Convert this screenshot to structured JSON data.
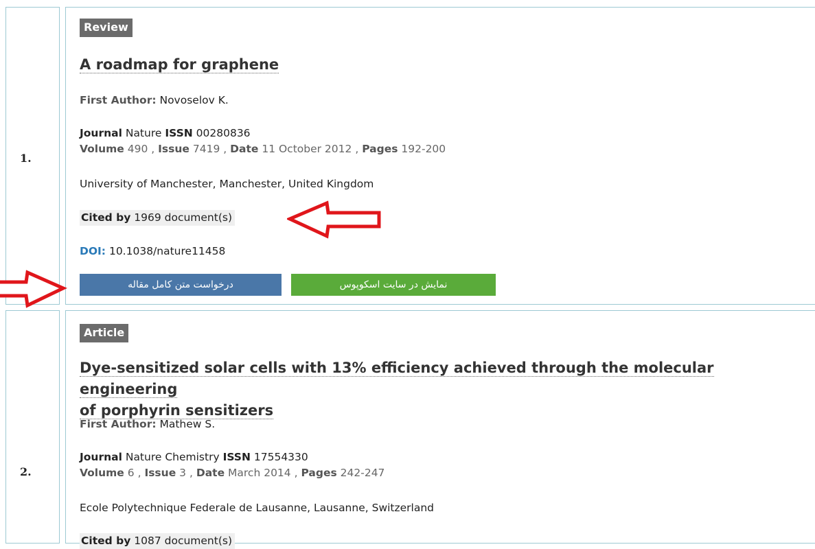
{
  "results": [
    {
      "number": "1.",
      "type": "Review",
      "title": "A roadmap for graphene",
      "first_author_label": "First Author:",
      "first_author": "Novoselov K.",
      "journal_label": "Journal",
      "journal": "Nature",
      "issn_label": "ISSN",
      "issn": "00280836",
      "volume_label": "Volume",
      "volume": "490",
      "issue_label": "Issue",
      "issue": "7419",
      "date_label": "Date",
      "date": "11 October 2012",
      "pages_label": "Pages",
      "pages": "192-200",
      "affiliation": "University of Manchester, Manchester, United Kingdom",
      "cited_label": "Cited by",
      "cited_text": "1969 document(s)",
      "doi_label": "DOI:",
      "doi": "10.1038/nature11458",
      "request_button": "درخواست متن کامل مقاله",
      "scopus_button": "نمایش در سایت اسکوپوس"
    },
    {
      "number": "2.",
      "type": "Article",
      "title_line1": "Dye-sensitized solar cells with 13% efficiency achieved through the molecular engineering",
      "title_line2": "of porphyrin sensitizers",
      "first_author_label": "First Author:",
      "first_author": "Mathew S.",
      "journal_label": "Journal",
      "journal": "Nature Chemistry",
      "issn_label": "ISSN",
      "issn": "17554330",
      "volume_label": "Volume",
      "volume": "6",
      "issue_label": "Issue",
      "issue": "3",
      "date_label": "Date",
      "date": "March 2014",
      "pages_label": "Pages",
      "pages": "242-247",
      "affiliation": "Ecole Polytechnique Federale de Lausanne, Lausanne, Switzerland",
      "cited_label": "Cited by",
      "cited_text": "1087 document(s)"
    }
  ],
  "separators": {
    "comma": ","
  },
  "colors": {
    "border": "#9cc9d3",
    "badge": "#6b6b6b",
    "request_button": "#4a77a8",
    "scopus_button": "#5aab3a",
    "doi_link": "#2a7ab8",
    "annotation_arrow": "#e0161b"
  },
  "annotations": [
    "arrow-left-icon",
    "arrow-right-icon"
  ]
}
